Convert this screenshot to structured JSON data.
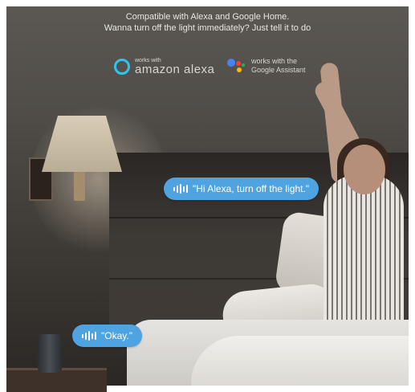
{
  "caption": {
    "line1": "Compatible with Alexa and Google Home.",
    "line2": "Wanna turn off the light immediately? Just tell it to do"
  },
  "logos": {
    "alexa": {
      "small": "works with",
      "big": "amazon alexa",
      "icon": "alexa-ring-icon"
    },
    "google": {
      "line1": "works with the",
      "line2": "Google Assistant",
      "icon": "google-assistant-icon"
    }
  },
  "bubbles": {
    "command": "\"Hi Alexa, turn off the light.\"",
    "reply": "\"Okay.\""
  },
  "colors": {
    "bubble": "#4ea3e0",
    "alexa": "#31c4f3",
    "google_blue": "#4285f4",
    "google_red": "#ea4335",
    "google_yellow": "#fbbc05",
    "google_green": "#34a853"
  }
}
